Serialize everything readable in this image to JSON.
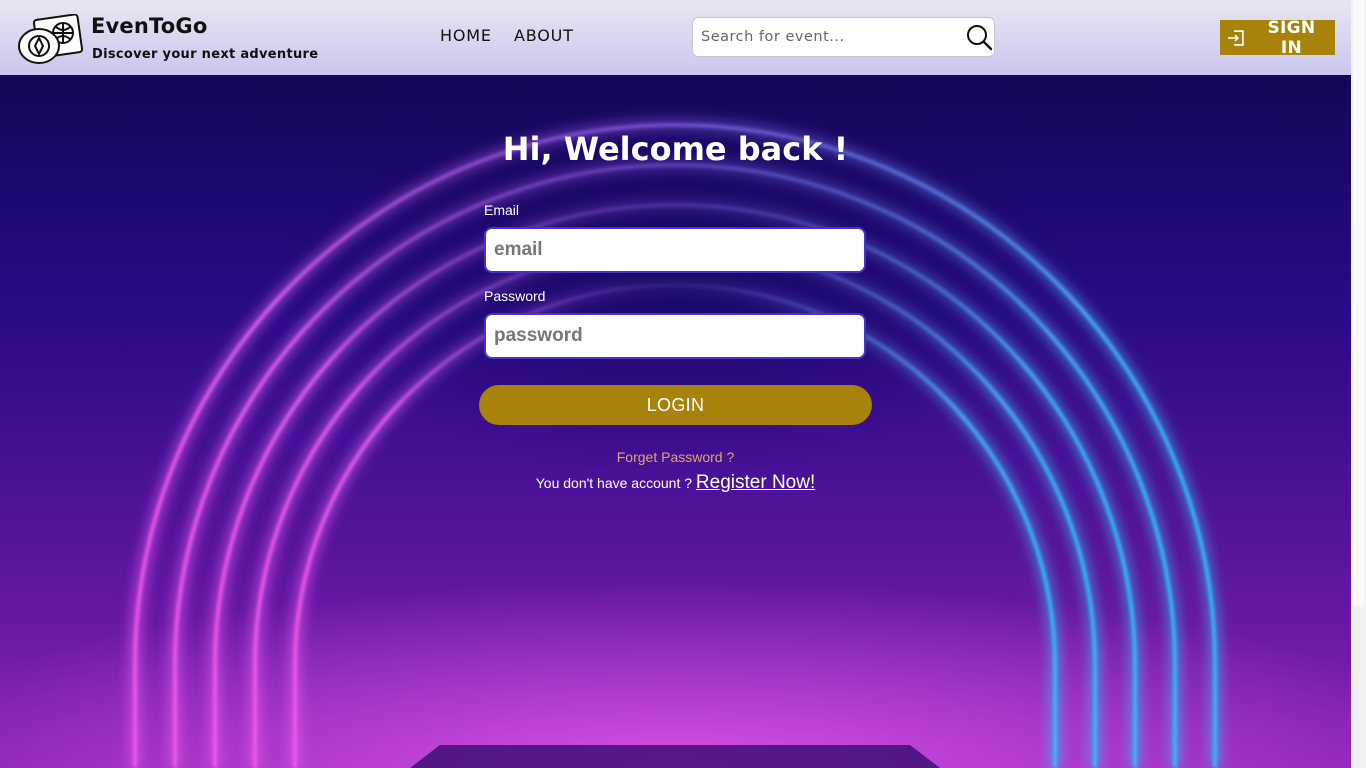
{
  "header": {
    "brand_name": "EvenToGo",
    "tagline": "Discover your next adventure",
    "nav": [
      {
        "label": "HOME"
      },
      {
        "label": "ABOUT"
      }
    ],
    "search": {
      "placeholder": "Search for event..."
    },
    "sign_in_label": "SIGN IN"
  },
  "login": {
    "title": "Hi, Welcome back !",
    "email_label": "Email",
    "email_placeholder": "email",
    "password_label": "Password",
    "password_placeholder": "password",
    "login_button": "LOGIN",
    "forget_password": "Forget Password ?",
    "no_account_text": "You don't have account ? ",
    "register_link": "Register Now!"
  },
  "colors": {
    "accent_gold": "#a7830b",
    "header_bg": "#d4d2f0",
    "hero_bg": "#2a0a7a",
    "forget_link": "#e1a56b",
    "input_border": "#4b30c9"
  },
  "icons": {
    "logo": "passport-globe-icon",
    "search": "search-icon",
    "sign_in": "sign-in-icon"
  }
}
